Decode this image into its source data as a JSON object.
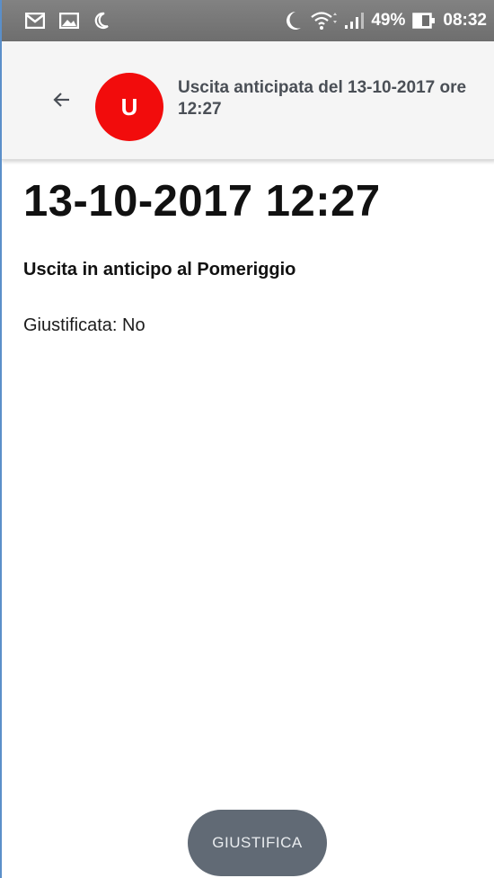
{
  "status_bar": {
    "left_icons": [
      "gmail-icon",
      "image-icon",
      "moon-icon"
    ],
    "battery_percent": "49%",
    "time": "08:32"
  },
  "app_bar": {
    "avatar_letter": "U",
    "avatar_color": "#f20c0c",
    "title": "Uscita anticipata del 13-10-2017 ore 12:27"
  },
  "content": {
    "date_time": "13-10-2017 12:27",
    "description": "Uscita in anticipo al Pomeriggio",
    "justified": "Giustificata: No"
  },
  "actions": {
    "justify_label": "GIUSTIFICA"
  }
}
